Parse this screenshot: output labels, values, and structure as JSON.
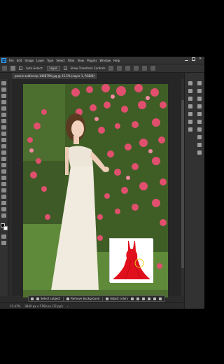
{
  "app": {
    "logo_text": "Ps",
    "menu": [
      "File",
      "Edit",
      "Image",
      "Layer",
      "Type",
      "Select",
      "Filter",
      "View",
      "Plugins",
      "Window",
      "Help"
    ]
  },
  "options_bar": {
    "auto_select_label": "Auto-Select:",
    "auto_select_value": "Layer",
    "transform_label": "Show Transform Controls"
  },
  "document_tab": {
    "title": "pexels-soldiervip-1468794.jpg @ 15.5% (Layer 1, RGB/8)"
  },
  "status_bar": {
    "zoom": "15.47%",
    "doc_size": "3840 px x 5760 px (72 ppi)"
  },
  "contextual_taskbar": {
    "select_subject": "Select subject",
    "remove_background": "Remove background",
    "adjust_colors": "Adjust colors"
  },
  "colors": {
    "accent": "#31a8ff",
    "dress_red": "#e0101c",
    "flower_pink": "#e0506e"
  }
}
